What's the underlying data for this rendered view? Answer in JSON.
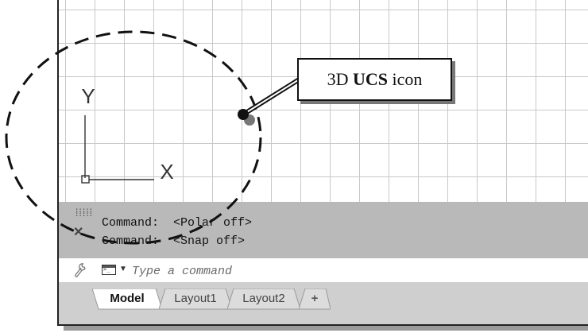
{
  "viewport": {
    "ucs_axes": {
      "y_label": "Y",
      "x_label": "X"
    }
  },
  "command_history": {
    "lines": [
      "Command:  <Polar off>",
      "Command:  <Snap off>"
    ]
  },
  "command_line": {
    "placeholder": "Type a command"
  },
  "tabs": {
    "model": "Model",
    "layout1": "Layout1",
    "layout2": "Layout2",
    "add": "+"
  },
  "annotation": {
    "prefix": "3D ",
    "bold": "UCS",
    "suffix": " icon"
  },
  "colors": {
    "history_bg": "#b9b9b9",
    "tabbar_bg": "#cfcfcf",
    "grid_line": "#c8c8c8"
  }
}
